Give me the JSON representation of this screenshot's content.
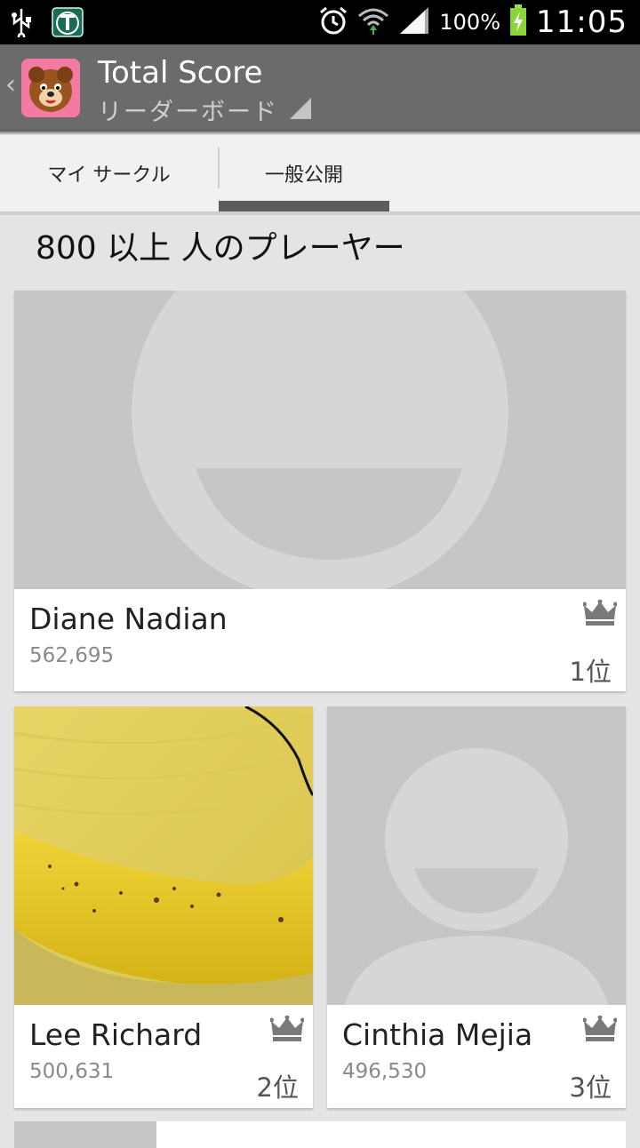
{
  "status_bar": {
    "battery_percent": "100%",
    "time": "11:05",
    "icons": [
      "usb-icon",
      "app-notification-icon",
      "alarm-icon",
      "wifi-icon",
      "signal-icon",
      "battery-charging-icon"
    ]
  },
  "action_bar": {
    "title": "Total Score",
    "subtitle": "リーダーボード",
    "back_icon": "‹"
  },
  "tabs": [
    {
      "label": "マイ サークル",
      "selected": false
    },
    {
      "label": "一般公開",
      "selected": true
    }
  ],
  "player_count": "800 以上 人のプレーヤー",
  "players": [
    {
      "name": "Diane Nadian",
      "score": "562,695",
      "rank": "1位",
      "photo": "default-avatar"
    },
    {
      "name": "Lee Richard",
      "score": "500,631",
      "rank": "2位",
      "photo": "banana-photo"
    },
    {
      "name": "Cinthia Mejia",
      "score": "496,530",
      "rank": "3位",
      "photo": "default-avatar"
    }
  ],
  "colors": {
    "action_bar": "#6b6b6b",
    "placeholder_bg": "#c6c6c6",
    "placeholder_face": "#d6d6d6",
    "tab_indicator": "#5c5c5c"
  }
}
